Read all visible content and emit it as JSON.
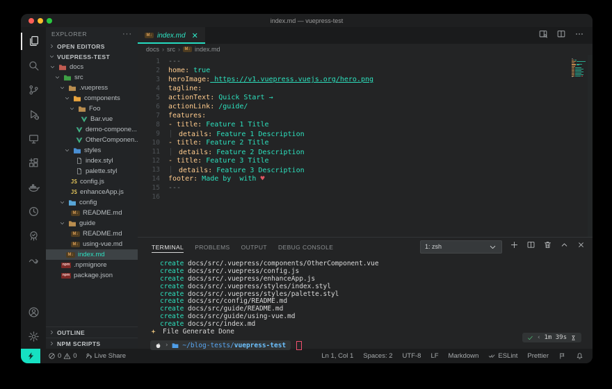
{
  "window": {
    "title": "index.md — vuepress-test"
  },
  "activity_bar": {
    "top": [
      {
        "name": "explorer-icon",
        "active": true
      },
      {
        "name": "search-icon"
      },
      {
        "name": "source-control-icon"
      },
      {
        "name": "run-debug-icon"
      },
      {
        "name": "remote-explorer-icon"
      },
      {
        "name": "extensions-icon"
      },
      {
        "name": "docker-icon"
      },
      {
        "name": "clock-extension-icon"
      },
      {
        "name": "tree-extension-icon"
      },
      {
        "name": "wave-extension-icon"
      }
    ],
    "bottom": [
      {
        "name": "accounts-icon"
      },
      {
        "name": "settings-gear-icon"
      }
    ]
  },
  "sidebar": {
    "title": "EXPLORER",
    "open_editors_label": "OPEN EDITORS",
    "root_label": "VUEPRESS-TEST",
    "outline_label": "OUTLINE",
    "npm_scripts_label": "NPM SCRIPTS",
    "tree": [
      {
        "name": "docs",
        "type": "folder",
        "icon": "folder-docs",
        "level": 0,
        "expanded": true
      },
      {
        "name": "src",
        "type": "folder",
        "icon": "folder-src",
        "level": 1,
        "expanded": true
      },
      {
        "name": ".vuepress",
        "type": "folder",
        "icon": "folder-vuepress",
        "level": 2,
        "expanded": true
      },
      {
        "name": "components",
        "type": "folder",
        "icon": "folder-components",
        "level": 3,
        "expanded": true
      },
      {
        "name": "Foo",
        "type": "folder",
        "icon": "folder-plain",
        "level": 4,
        "expanded": true
      },
      {
        "name": "Bar.vue",
        "type": "file",
        "icon": "vue",
        "level": 5
      },
      {
        "name": "demo-compone...",
        "type": "file",
        "icon": "vue",
        "level": 4
      },
      {
        "name": "OtherComponen...",
        "type": "file",
        "icon": "vue",
        "level": 4
      },
      {
        "name": "styles",
        "type": "folder",
        "icon": "folder-styles",
        "level": 3,
        "expanded": true
      },
      {
        "name": "index.styl",
        "type": "file",
        "icon": "doc",
        "level": 4
      },
      {
        "name": "palette.styl",
        "type": "file",
        "icon": "doc",
        "level": 4
      },
      {
        "name": "config.js",
        "type": "file",
        "icon": "js",
        "level": 3
      },
      {
        "name": "enhanceApp.js",
        "type": "file",
        "icon": "js",
        "level": 3
      },
      {
        "name": "config",
        "type": "folder",
        "icon": "folder-config",
        "level": 2,
        "expanded": true
      },
      {
        "name": "README.md",
        "type": "file",
        "icon": "md",
        "level": 3
      },
      {
        "name": "guide",
        "type": "folder",
        "icon": "folder-guide",
        "level": 2,
        "expanded": true
      },
      {
        "name": "README.md",
        "type": "file",
        "icon": "md",
        "level": 3
      },
      {
        "name": "using-vue.md",
        "type": "file",
        "icon": "md",
        "level": 3
      },
      {
        "name": "index.md",
        "type": "file",
        "icon": "md",
        "level": 2,
        "selected": true
      },
      {
        "name": ".npmignore",
        "type": "file",
        "icon": "npm",
        "level": 1
      },
      {
        "name": "package.json",
        "type": "file",
        "icon": "npm",
        "level": 1
      }
    ]
  },
  "editor": {
    "tab": {
      "label": "index.md",
      "icon": "md"
    },
    "breadcrumbs": [
      "docs",
      "src",
      "index.md"
    ],
    "lines": [
      {
        "n": 1,
        "tokens": [
          [
            "m",
            "---"
          ]
        ]
      },
      {
        "n": 2,
        "tokens": [
          [
            "k",
            "home:"
          ],
          [
            "v",
            " true"
          ]
        ]
      },
      {
        "n": 3,
        "tokens": [
          [
            "k",
            "heroImage:"
          ],
          [
            "l",
            " https://v1.vuepress.vuejs.org/hero.png"
          ]
        ]
      },
      {
        "n": 4,
        "tokens": [
          [
            "k",
            "tagline:"
          ]
        ]
      },
      {
        "n": 5,
        "tokens": [
          [
            "k",
            "actionText:"
          ],
          [
            "v",
            " Quick Start →"
          ]
        ]
      },
      {
        "n": 6,
        "tokens": [
          [
            "k",
            "actionLink:"
          ],
          [
            "v",
            " /guide/"
          ]
        ]
      },
      {
        "n": 7,
        "tokens": [
          [
            "k",
            "features:"
          ]
        ]
      },
      {
        "n": 8,
        "tokens": [
          [
            "k",
            "- title:"
          ],
          [
            "v",
            " Feature 1 Title"
          ]
        ]
      },
      {
        "n": 9,
        "tokens": [
          [
            "g",
            ""
          ],
          [
            "k",
            "details:"
          ],
          [
            "v",
            " Feature 1 Description"
          ]
        ]
      },
      {
        "n": 10,
        "tokens": [
          [
            "k",
            "- title:"
          ],
          [
            "v",
            " Feature 2 Title"
          ]
        ]
      },
      {
        "n": 11,
        "tokens": [
          [
            "g",
            ""
          ],
          [
            "k",
            "details:"
          ],
          [
            "v",
            " Feature 2 Description"
          ]
        ]
      },
      {
        "n": 12,
        "tokens": [
          [
            "k",
            "- title:"
          ],
          [
            "v",
            " Feature 3 Title"
          ]
        ]
      },
      {
        "n": 13,
        "tokens": [
          [
            "g",
            ""
          ],
          [
            "k",
            "details:"
          ],
          [
            "v",
            " Feature 3 Description"
          ]
        ]
      },
      {
        "n": 14,
        "tokens": [
          [
            "k",
            "footer:"
          ],
          [
            "v",
            " Made by  with "
          ],
          [
            "h",
            "♥"
          ]
        ]
      },
      {
        "n": 15,
        "tokens": [
          [
            "m",
            "---"
          ]
        ]
      },
      {
        "n": 16,
        "tokens": []
      }
    ]
  },
  "panel": {
    "tabs": [
      {
        "label": "TERMINAL",
        "active": true
      },
      {
        "label": "PROBLEMS"
      },
      {
        "label": "OUTPUT"
      },
      {
        "label": "DEBUG CONSOLE"
      }
    ],
    "shell_selector": "1: zsh",
    "terminal": {
      "create_prefix": "create",
      "created_paths": [
        "docs/src/.vuepress/components/OtherComponent.vue",
        "docs/src/.vuepress/config.js",
        "docs/src/.vuepress/enhanceApp.js",
        "docs/src/.vuepress/styles/index.styl",
        "docs/src/.vuepress/styles/palette.styl",
        "docs/src/config/README.md",
        "docs/src/guide/README.md",
        "docs/src/guide/using-vue.md",
        "docs/src/index.md"
      ],
      "done_text": "File Generate Done",
      "prompt": {
        "path_dir": "~/blog-tests/",
        "path_name": "vuepress-test"
      },
      "right_prompt": {
        "duration": "1m 39s"
      }
    }
  },
  "status_bar": {
    "errors": "0",
    "warnings": "0",
    "live_share_label": "Live Share",
    "right_items": [
      {
        "label": "Ln 1, Col 1"
      },
      {
        "label": "Spaces: 2"
      },
      {
        "label": "UTF-8"
      },
      {
        "label": "LF"
      },
      {
        "label": "Markdown"
      },
      {
        "label": "ESLint",
        "icon": "double-check-icon"
      },
      {
        "label": "Prettier"
      }
    ]
  },
  "colors": {
    "accent_teal": "#24dcc0",
    "key_orange": "#ffcb8d",
    "value_teal": "#2de0bd",
    "remote_badge": "#16e0c2",
    "cursor_red": "#f2506e"
  }
}
